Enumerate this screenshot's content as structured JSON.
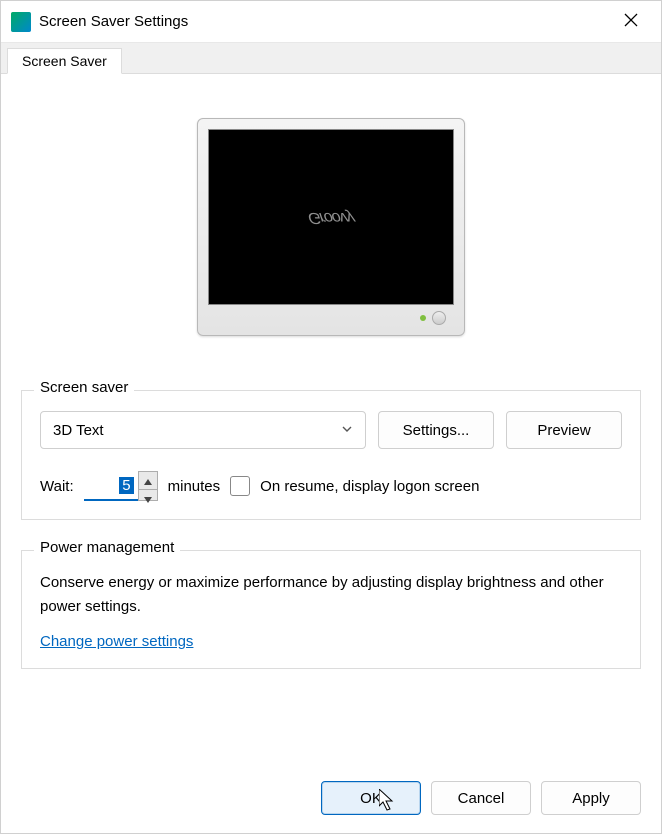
{
  "window": {
    "title": "Screen Saver Settings"
  },
  "tabs": {
    "active": "Screen Saver"
  },
  "preview": {
    "text": "Groovy"
  },
  "screensaver": {
    "legend": "Screen saver",
    "selected": "3D Text",
    "settings_btn": "Settings...",
    "preview_btn": "Preview",
    "wait_label": "Wait:",
    "wait_value": "5",
    "wait_unit": "minutes",
    "resume_label": "On resume, display logon screen",
    "resume_checked": false
  },
  "power": {
    "legend": "Power management",
    "description": "Conserve energy or maximize performance by adjusting display brightness and other power settings.",
    "link": "Change power settings"
  },
  "buttons": {
    "ok": "OK",
    "cancel": "Cancel",
    "apply": "Apply"
  }
}
